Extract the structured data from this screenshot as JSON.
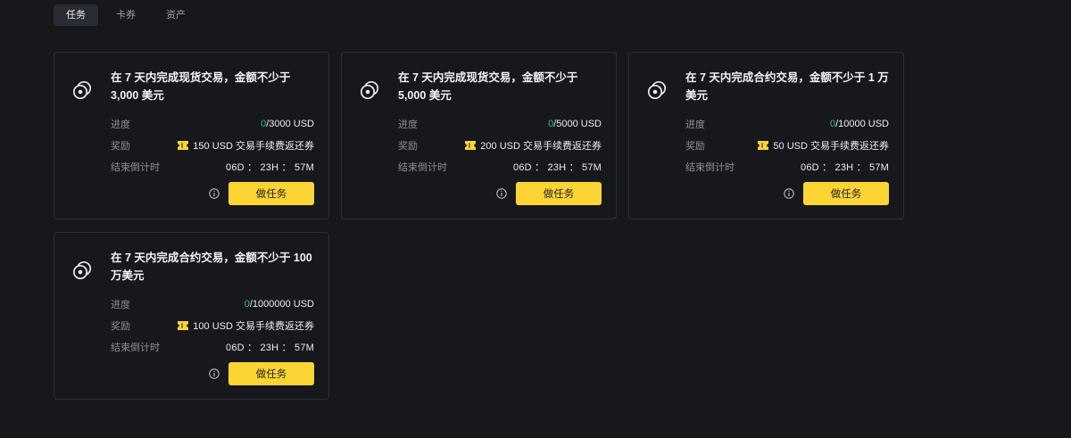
{
  "tabs": [
    {
      "label": "任务",
      "active": true
    },
    {
      "label": "卡券",
      "active": false
    },
    {
      "label": "资产",
      "active": false
    }
  ],
  "labels": {
    "progress": "进度",
    "reward": "奖励",
    "countdown": "结束倒计时",
    "action": "做任务"
  },
  "colors": {
    "accent": "#fcd535",
    "progress_done": "#2ebd85",
    "background": "#17181c",
    "card_border": "#2d2f36"
  },
  "icons": {
    "task": "coin-target-icon",
    "reward": "ticket-icon",
    "info": "info-icon"
  },
  "cards": [
    {
      "title": "在 7 天内完成现货交易，金额不少于 3,000 美元",
      "progress_current": "0",
      "progress_total": "/3000 USD",
      "reward": "150 USD 交易手续费返还券",
      "countdown": "06D ： 23H ： 57M"
    },
    {
      "title": "在 7 天内完成现货交易，金额不少于 5,000 美元",
      "progress_current": "0",
      "progress_total": "/5000 USD",
      "reward": "200 USD 交易手续费返还券",
      "countdown": "06D ： 23H ： 57M"
    },
    {
      "title": "在 7 天内完成合约交易，金额不少于 1 万美元",
      "progress_current": "0",
      "progress_total": "/10000 USD",
      "reward": "50 USD 交易手续费返还券",
      "countdown": "06D ： 23H ： 57M"
    },
    {
      "title": "在 7 天内完成合约交易，金额不少于 100 万美元",
      "progress_current": "0",
      "progress_total": "/1000000 USD",
      "reward": "100 USD 交易手续费返还券",
      "countdown": "06D ： 23H ： 57M"
    }
  ]
}
